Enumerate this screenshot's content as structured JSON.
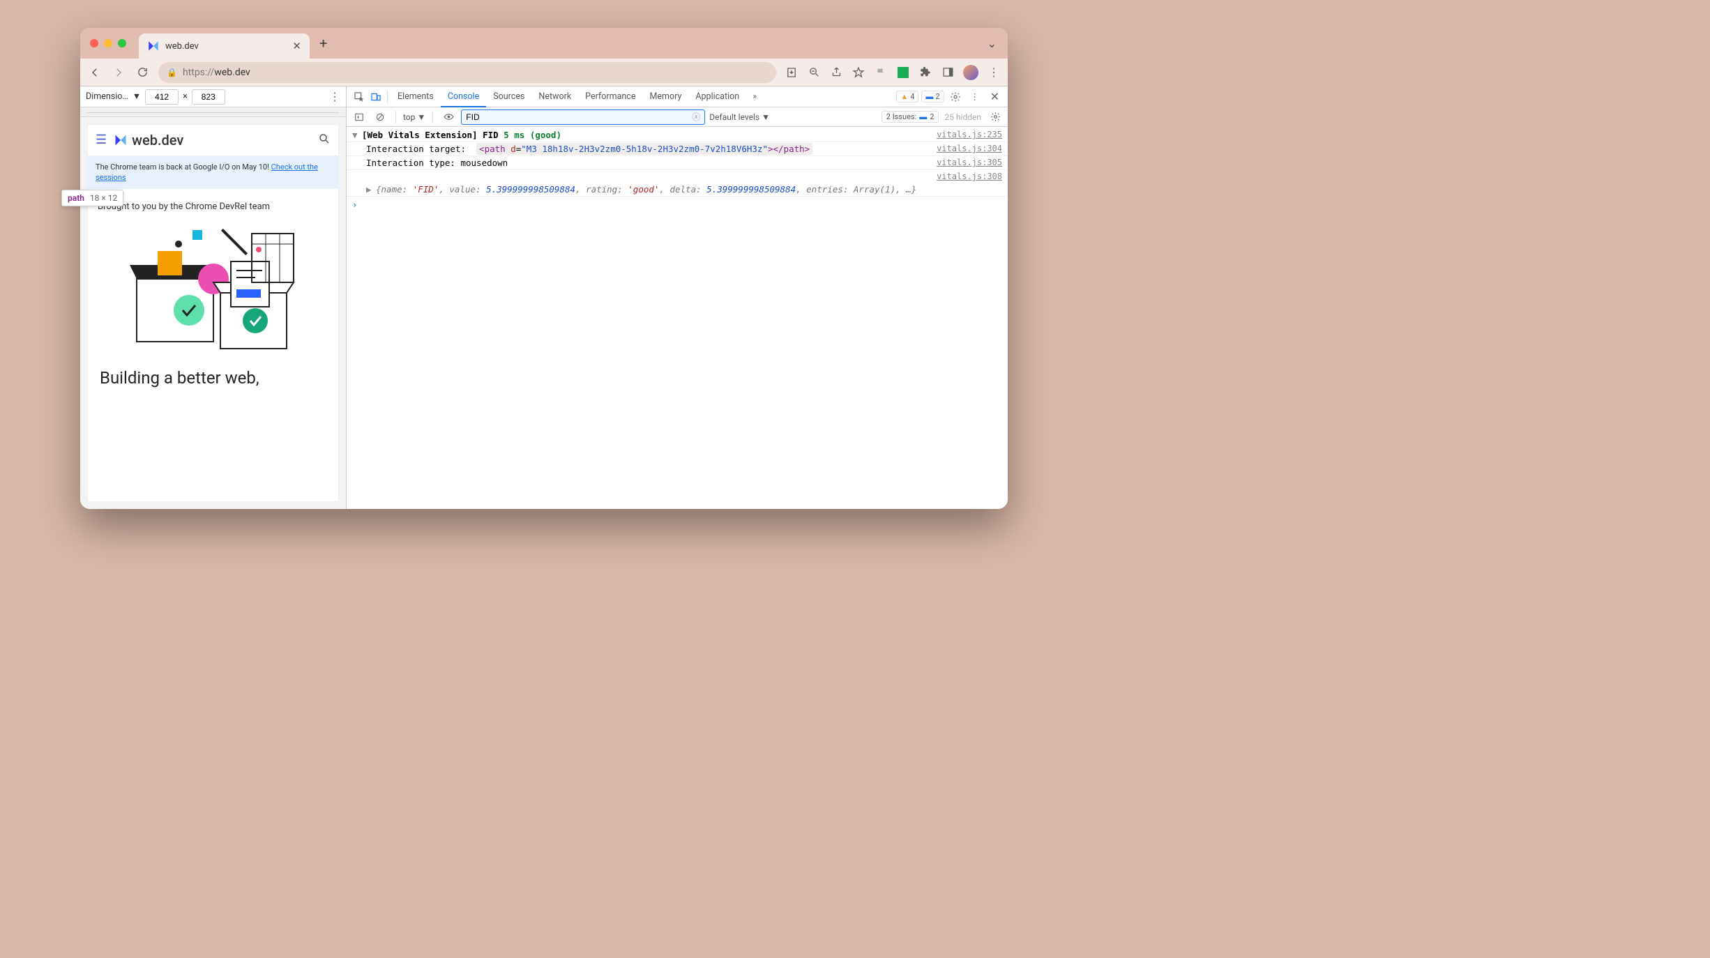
{
  "browser": {
    "tab_title": "web.dev",
    "url_scheme": "https://",
    "url_host": "web.dev"
  },
  "device_toolbar": {
    "label": "Dimensio…",
    "width": "412",
    "sep": "×",
    "height": "823"
  },
  "page": {
    "logo_text": "web.dev",
    "tooltip_tag": "path",
    "tooltip_dim": "18 × 12",
    "banner_text": "The Chrome team is back at Google I/O on May 10! ",
    "banner_link": "Check out the sessions",
    "subhead": "Brought to you by the Chrome DevRel team",
    "headline": "Building a better web,"
  },
  "devtools": {
    "tabs": [
      "Elements",
      "Console",
      "Sources",
      "Network",
      "Performance",
      "Memory",
      "Application"
    ],
    "active_tab": "Console",
    "warn_count": "4",
    "info_count": "2"
  },
  "console_toolbar": {
    "context": "top",
    "filter_value": "FID",
    "levels": "Default levels",
    "issues_label": "2 Issues:",
    "issues_count": "2",
    "hidden": "25 hidden"
  },
  "console": {
    "r1_prefix": "[Web Vitals Extension] FID",
    "r1_metric": " 5 ms (good)",
    "r1_src": "vitals.js:235",
    "r2_label": "Interaction target: ",
    "r2_tag_open": "<path ",
    "r2_attr": "d",
    "r2_eq": "=",
    "r2_val": "\"M3 18h18v-2H3v2zm0-5h18v-2H3v2zm0-7v2h18V6H3z\"",
    "r2_tag_close": "></path>",
    "r2_src": "vitals.js:304",
    "r3_text": "Interaction type: mousedown",
    "r3_src": "vitals.js:305",
    "r4_src": "vitals.js:308",
    "r5_obj_open": "{name: ",
    "r5_name": "'FID'",
    "r5_sep1": ", value: ",
    "r5_value": "5.399999998509884",
    "r5_sep2": ", rating: ",
    "r5_rating": "'good'",
    "r5_sep3": ", delta: ",
    "r5_delta": "5.399999998509884",
    "r5_sep4": ", entries: ",
    "r5_entries": "Array(1)",
    "r5_close": ", …}"
  }
}
